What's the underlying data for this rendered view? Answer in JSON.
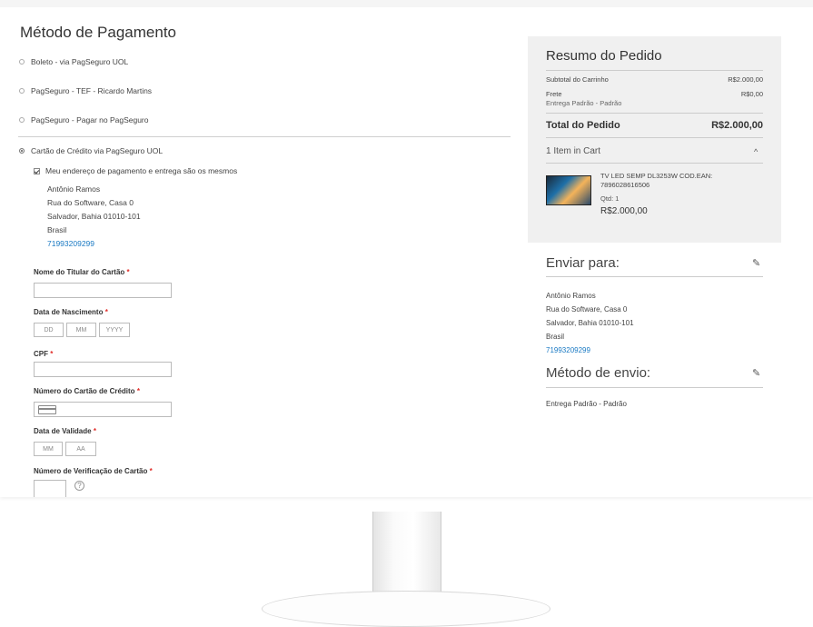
{
  "payment": {
    "title": "Método de Pagamento",
    "methods": [
      {
        "label": "Boleto - via PagSeguro UOL",
        "selected": false
      },
      {
        "label": "PagSeguro - TEF - Ricardo Martins",
        "selected": false
      },
      {
        "label": "PagSeguro - Pagar no PagSeguro",
        "selected": false
      },
      {
        "label": "Cartão de Crédito via PagSeguro UOL",
        "selected": true
      }
    ],
    "same_address_label": "Meu endereço de pagamento e entrega são os mesmos",
    "same_address_checked": true,
    "billing_address": {
      "name": "Antônio Ramos",
      "street": "Rua do Software, Casa 0",
      "city": "Salvador, Bahia 01010-101",
      "country": "Brasil",
      "phone": "71993209299"
    },
    "form": {
      "holder_label": "Nome do Titular do Cartão",
      "birth_label": "Data de Nascimento",
      "birth_dd": "DD",
      "birth_mm": "MM",
      "birth_yyyy": "YYYY",
      "cpf_label": "CPF",
      "card_number_label": "Número do Cartão de Crédito",
      "expiry_label": "Data de Validade",
      "expiry_mm": "MM",
      "expiry_aa": "AA",
      "cvv_label": "Número de Verificação de Cartão",
      "help_symbol": "?",
      "required_mark": "*"
    }
  },
  "summary": {
    "title": "Resumo do Pedido",
    "subtotal_label": "Subtotal do Carrinho",
    "subtotal_value": "R$2.000,00",
    "shipping_label": "Frete",
    "shipping_method": "Entrega Padrão - Padrão",
    "shipping_value": "R$0,00",
    "total_label": "Total do Pedido",
    "total_value": "R$2.000,00",
    "items_count": "1 Item in Cart",
    "item": {
      "name": "TV LED SEMP DL3253W COD.EAN: 7896028616506",
      "qty": "Qtd: 1",
      "price": "R$2.000,00"
    }
  },
  "ship_to": {
    "title": "Enviar para:",
    "name": "Antônio Ramos",
    "street": "Rua do Software, Casa 0",
    "city": "Salvador, Bahia 01010-101",
    "country": "Brasil",
    "phone": "71993209299"
  },
  "ship_method": {
    "title": "Método de envio:",
    "value": "Entrega Padrão - Padrão"
  },
  "icons": {
    "pencil": "✎",
    "chevron_up": "^"
  },
  "colors": {
    "link": "#1979c3",
    "required": "#e02b27",
    "summary_bg": "#f0f0f0"
  }
}
